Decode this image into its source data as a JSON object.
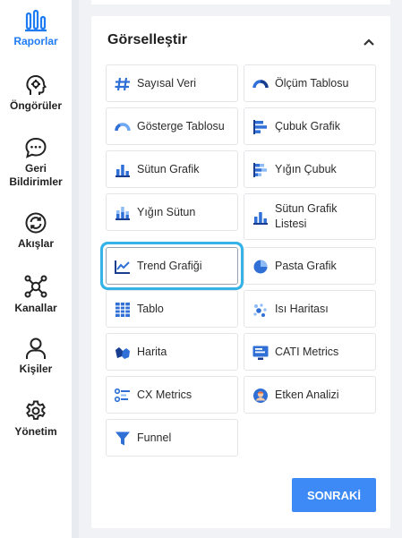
{
  "sidebar": {
    "items": [
      {
        "label": "Raporlar",
        "icon": "bar-chart-icon",
        "active": true
      },
      {
        "label": "Öngörüler",
        "icon": "head-insight-icon"
      },
      {
        "label": "Geri Bildirimler",
        "icon": "chat-bubble-icon"
      },
      {
        "label": "Akışlar",
        "icon": "sync-icon"
      },
      {
        "label": "Kanallar",
        "icon": "network-icon"
      },
      {
        "label": "Kişiler",
        "icon": "person-icon"
      },
      {
        "label": "Yönetim",
        "icon": "gear-icon"
      }
    ]
  },
  "panel": {
    "title": "Görselleştir",
    "next_label": "SONRAKİ"
  },
  "tiles": [
    {
      "label": "Sayısal Veri",
      "icon": "hash-icon"
    },
    {
      "label": "Ölçüm Tablosu",
      "icon": "gauge-icon"
    },
    {
      "label": "Gösterge Tablosu",
      "icon": "gauge-dashboard-icon"
    },
    {
      "label": "Çubuk Grafik",
      "icon": "horizontal-bar-icon"
    },
    {
      "label": "Sütun Grafik",
      "icon": "column-chart-icon"
    },
    {
      "label": "Yığın Çubuk",
      "icon": "stacked-bar-icon"
    },
    {
      "label": "Yığın Sütun",
      "icon": "stacked-column-icon"
    },
    {
      "label": "Sütun Grafik Listesi",
      "icon": "column-list-icon"
    },
    {
      "label": "Trend Grafiği",
      "icon": "trend-line-icon",
      "selected": true
    },
    {
      "label": "Pasta Grafik",
      "icon": "pie-chart-icon"
    },
    {
      "label": "Tablo",
      "icon": "table-icon"
    },
    {
      "label": "Isı Haritası",
      "icon": "heatmap-icon"
    },
    {
      "label": "Harita",
      "icon": "map-icon"
    },
    {
      "label": "CATI Metrics",
      "icon": "cati-icon"
    },
    {
      "label": "CX Metrics",
      "icon": "cx-metrics-icon"
    },
    {
      "label": "Etken Analizi",
      "icon": "driver-avatar-icon"
    },
    {
      "label": "Funnel",
      "icon": "funnel-icon"
    }
  ],
  "colors": {
    "accent": "#1e7bf2",
    "button": "#3d8af7",
    "selection": "#36b3e6"
  }
}
